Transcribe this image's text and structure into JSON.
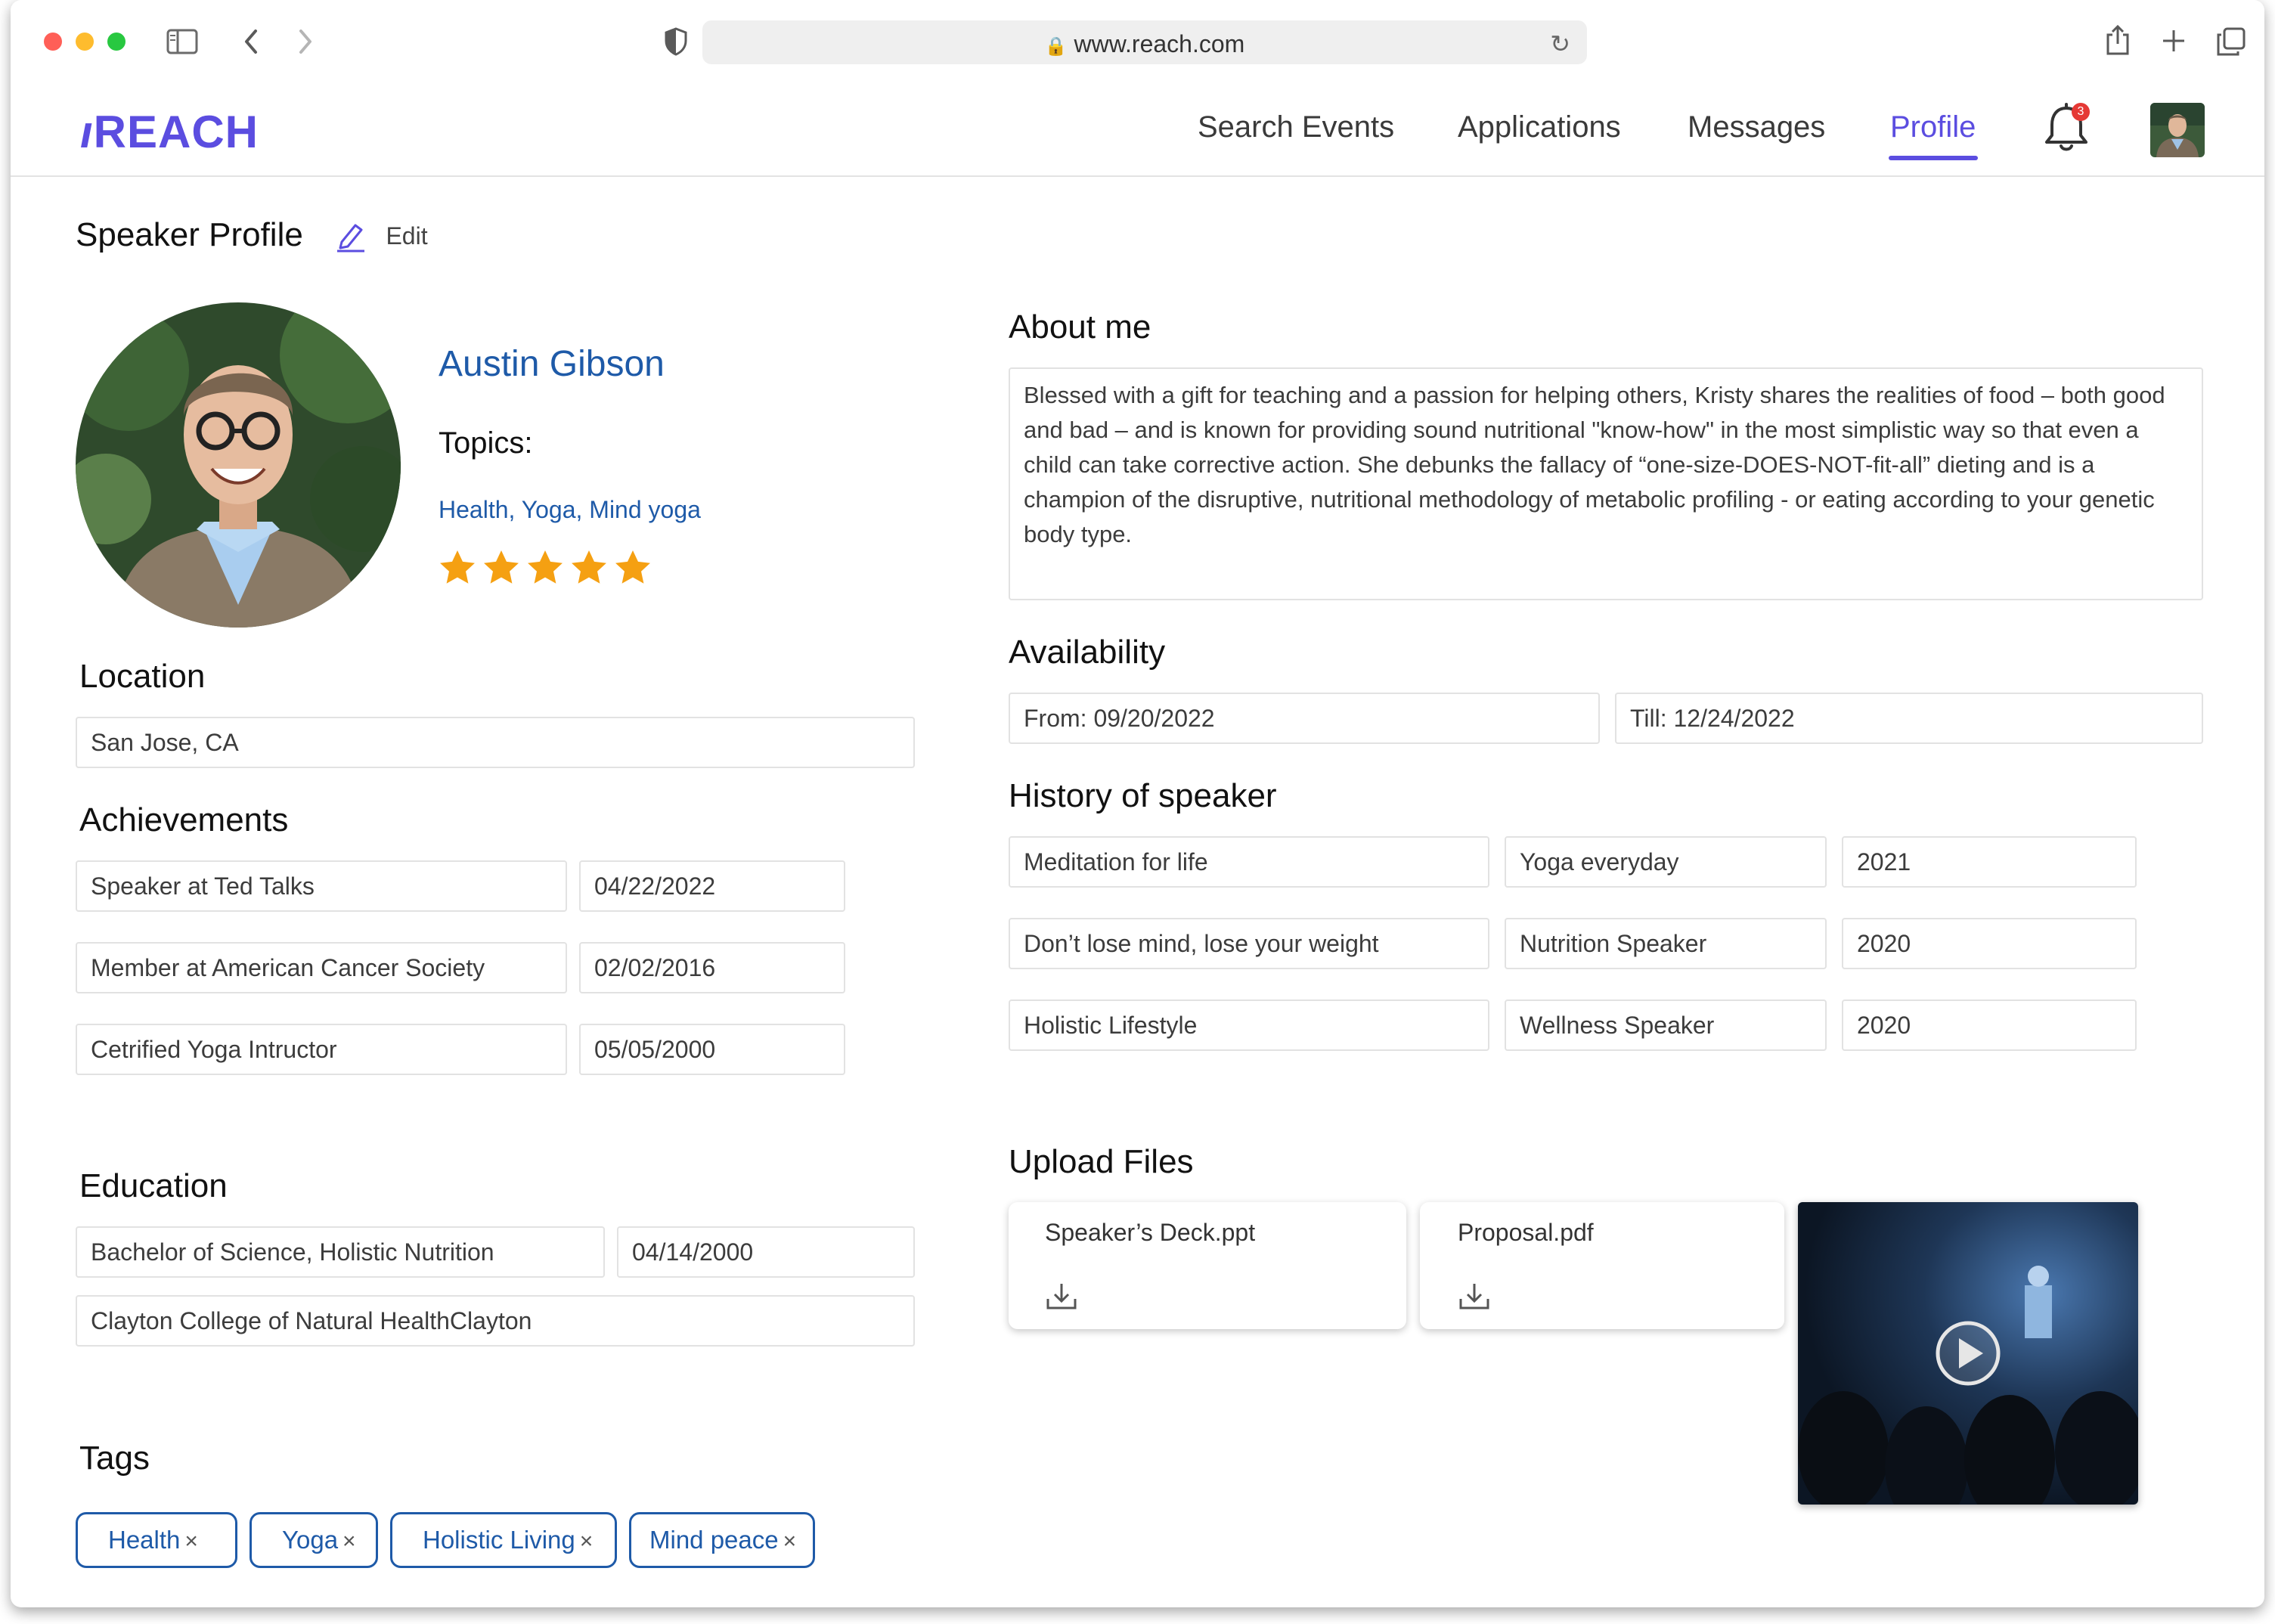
{
  "browser": {
    "url": "www.reach.com",
    "icons": [
      "sidebar-icon",
      "back-icon",
      "forward-icon",
      "shield-icon",
      "lock-icon",
      "reload-icon",
      "share-icon",
      "new-tab-icon",
      "tabs-icon"
    ]
  },
  "nav": {
    "logo": "REACH",
    "links": [
      "Search  Events",
      "Applications",
      "Messages",
      "Profile"
    ],
    "active": "Profile",
    "notification_count": "3"
  },
  "page": {
    "title": "Speaker Profile",
    "edit_label": "Edit"
  },
  "profile": {
    "name": "Austin Gibson",
    "topics_label": "Topics:",
    "topics": "Health, Yoga, Mind yoga",
    "rating": 5,
    "rating_max": 5
  },
  "location": {
    "title": "Location",
    "value": "San Jose, CA"
  },
  "achievements": {
    "title": "Achievements",
    "items": [
      {
        "name": "Speaker at Ted Talks",
        "date": "04/22/2022"
      },
      {
        "name": "Member at American Cancer Society",
        "date": "02/02/2016"
      },
      {
        "name": "Cetrified Yoga Intructor",
        "date": "05/05/2000"
      }
    ]
  },
  "education": {
    "title": "Education",
    "degree": "Bachelor of Science, Holistic Nutrition",
    "date": "04/14/2000",
    "school": "Clayton College of Natural HealthClayton"
  },
  "tags": {
    "title": "Tags",
    "items": [
      "Health",
      "Yoga",
      "Holistic Living",
      "Mind peace"
    ],
    "remove_glyph": "×"
  },
  "about": {
    "title": "About me",
    "text": "Blessed with a gift for teaching and a passion for helping others, Kristy shares the realities of food – both good and bad – and is known for providing sound nutritional \"know-how\" in the most simplistic way so that even a child can take corrective action. She debunks the fallacy of “one-size-DOES-NOT-fit-all” dieting and is a champion of the disruptive, nutritional methodology of metabolic profiling - or eating according to your genetic body type."
  },
  "availability": {
    "title": "Availability",
    "from": "From: 09/20/2022",
    "till": "Till: 12/24/2022"
  },
  "history": {
    "title": "History of speaker",
    "rows": [
      {
        "event": "Meditation for life",
        "role": "Yoga everyday",
        "year": "2021"
      },
      {
        "event": "Don’t lose mind, lose your weight",
        "role": "Nutrition  Speaker",
        "year": "2020"
      },
      {
        "event": "Holistic Lifestyle",
        "role": "Wellness Speaker",
        "year": "2020"
      }
    ]
  },
  "uploads": {
    "title": "Upload Files",
    "files": [
      "Speaker’s Deck.ppt",
      "Proposal.pdf"
    ]
  },
  "colors": {
    "accent": "#5b4de0",
    "link_blue": "#1e5aa8",
    "star": "#f5a012",
    "badge": "#e53935"
  }
}
